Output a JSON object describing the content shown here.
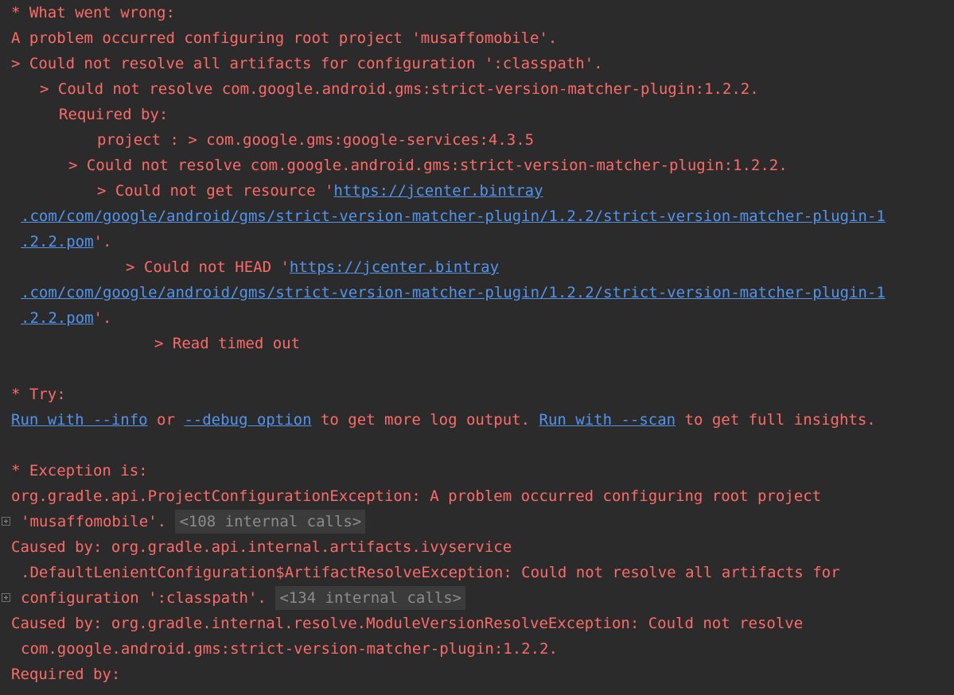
{
  "console": {
    "what_went_wrong": "* What went wrong:",
    "problem_line": "A problem occurred configuring root project 'musaffomobile'.",
    "could_not_resolve_all": "> Could not resolve all artifacts for configuration ':classpath'.",
    "could_not_resolve_plugin_1": "> Could not resolve com.google.android.gms:strict-version-matcher-plugin:1.2.2.",
    "required_by_1": "Required by:",
    "project_dep": "project : > com.google.gms:google-services:4.3.5",
    "could_not_resolve_plugin_2": "> Could not resolve com.google.android.gms:strict-version-matcher-plugin:1.2.2.",
    "get_resource_prefix": "> Could not get resource '",
    "get_resource_url_1": "https://jcenter.bintray",
    "get_resource_url_2": ".com/com/google/android/gms/strict-version-matcher-plugin/1.2.2/strict-version-matcher-plugin-1",
    "get_resource_url_3": ".2.2.pom",
    "get_resource_suffix": "'.",
    "head_prefix": "> Could not HEAD '",
    "head_url_1": "https://jcenter.bintray",
    "head_url_2": ".com/com/google/android/gms/strict-version-matcher-plugin/1.2.2/strict-version-matcher-plugin-1",
    "head_url_3": ".2.2.pom",
    "head_suffix": "'.",
    "read_timed_out": "> Read timed out",
    "try_header": "* Try:",
    "run_info_link": "Run with --info",
    "or_text": " or ",
    "debug_link": "--debug option",
    "more_log_text": " to get more log output. ",
    "run_scan_link": "Run with --scan",
    "full_insights_text": " to get full insights.",
    "exception_header": "* Exception is:",
    "exception_line_1": "org.gradle.api.ProjectConfigurationException: A problem occurred configuring root project",
    "exception_line_2": "'musaffomobile'.",
    "internal_calls_1": "<108 internal calls>",
    "caused_by_1a": "Caused by: org.gradle.api.internal.artifacts.ivyservice",
    "caused_by_1b": ".DefaultLenientConfiguration$ArtifactResolveException: Could not resolve all artifacts for",
    "caused_by_1c": "configuration ':classpath'.",
    "internal_calls_2": "<134 internal calls>",
    "caused_by_2a": "Caused by: org.gradle.internal.resolve.ModuleVersionResolveException: Could not resolve",
    "caused_by_2b": "com.google.android.gms:strict-version-matcher-plugin:1.2.2.",
    "required_by_2": "Required by:"
  }
}
